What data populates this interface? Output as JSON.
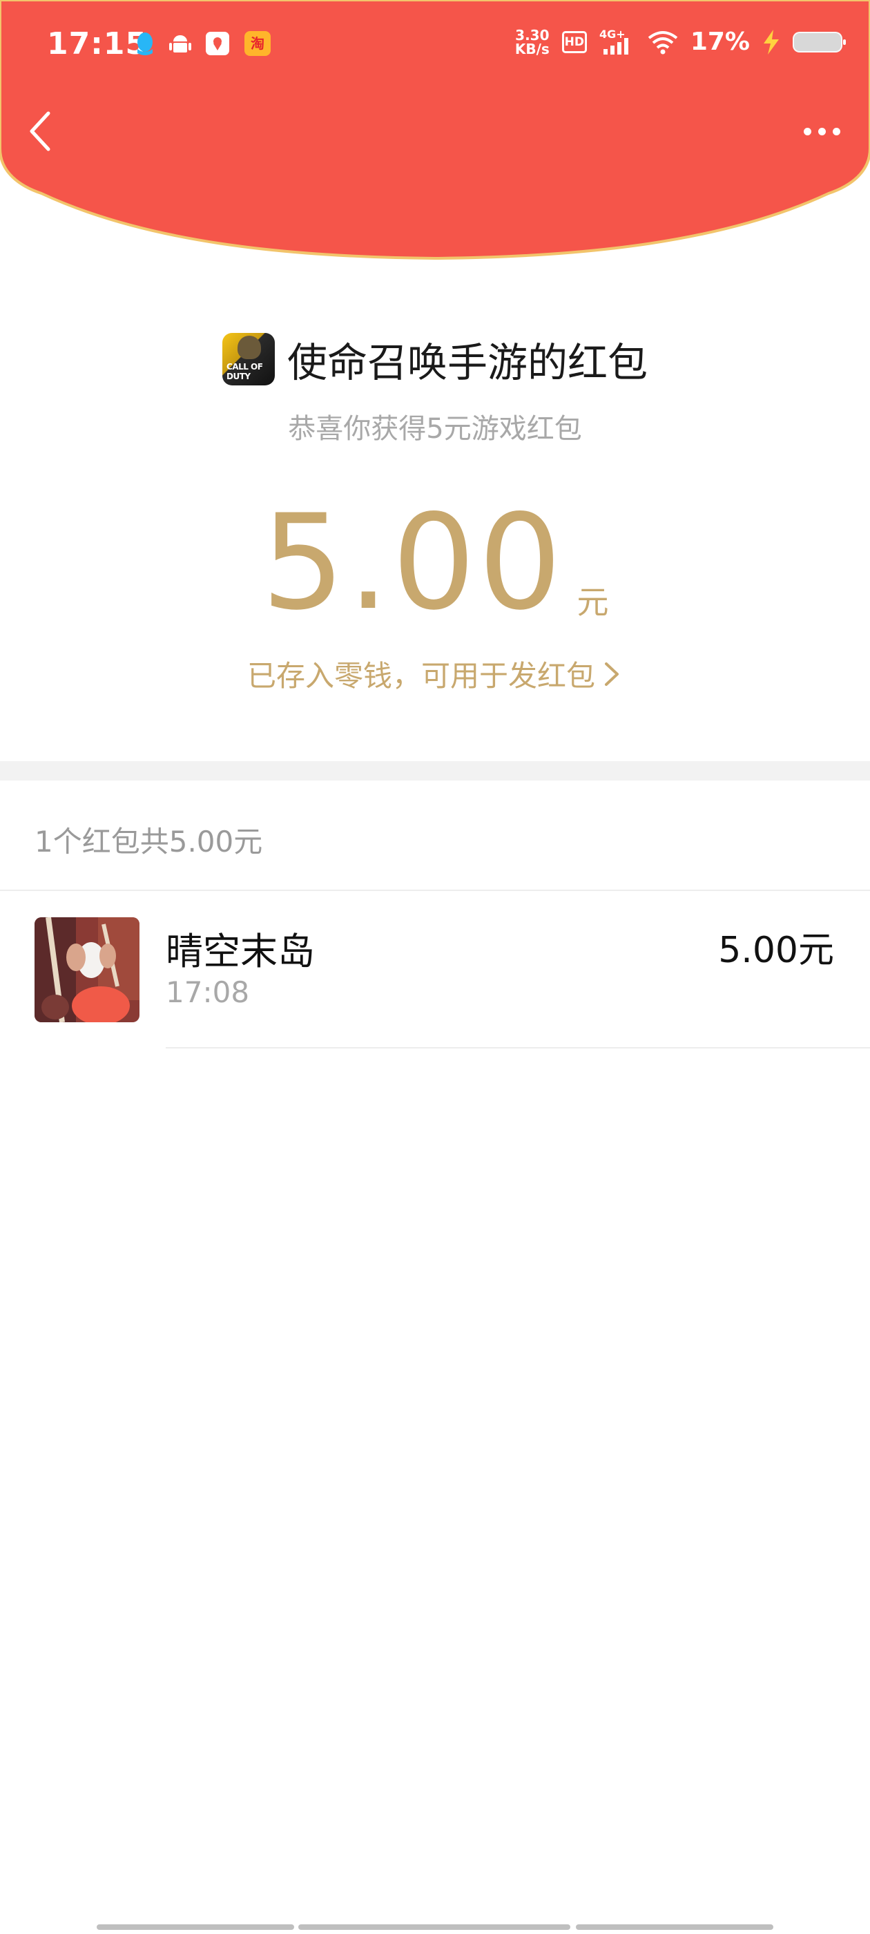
{
  "status_bar": {
    "time": "17:15",
    "net_speed_value": "3.30",
    "net_speed_unit": "KB/s",
    "hd_label": "HD",
    "network_label": "4G+",
    "battery_percent": "17%",
    "icons": [
      "qq-icon",
      "android-icon",
      "map-app-icon",
      "taobao-icon",
      "signal-icon",
      "wifi-icon",
      "charging-icon",
      "battery-icon"
    ]
  },
  "header": {
    "color": "#f5554a",
    "edge_color": "#f2c46b"
  },
  "packet": {
    "title": "使命召唤手游的红包",
    "game_icon_text": "CALL OF DUTY",
    "subtitle": "恭喜你获得5元游戏红包",
    "amount": "5.00",
    "unit": "元",
    "saved_note": "已存入零钱，可用于发红包",
    "accent_color": "#c8a86e"
  },
  "records": {
    "summary": "1个红包共5.00元",
    "items": [
      {
        "name": "晴空末岛",
        "time": "17:08",
        "amount": "5.00元"
      }
    ]
  }
}
